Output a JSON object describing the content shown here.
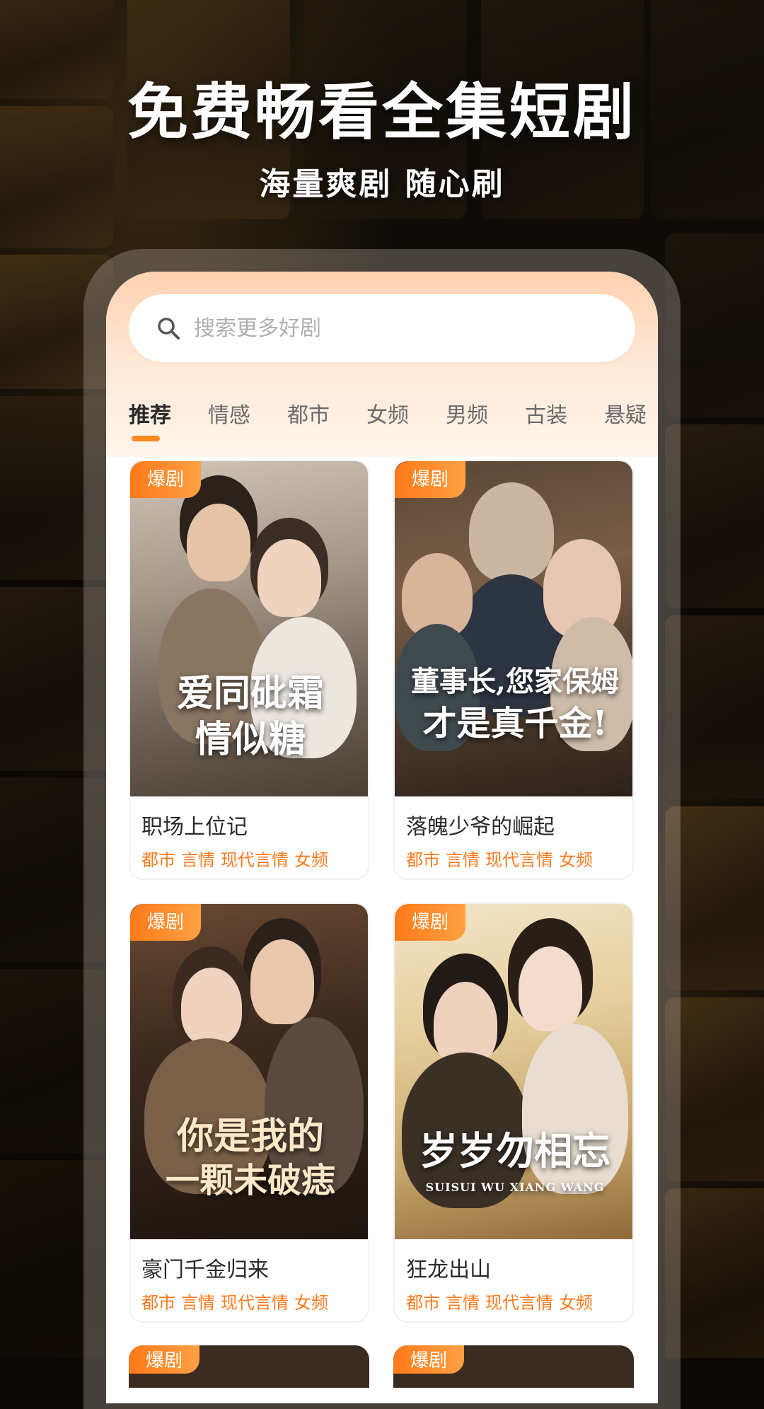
{
  "promo": {
    "headline": "免费畅看全集短剧",
    "subheadline": "海量爽剧 随心刷"
  },
  "search": {
    "placeholder": "搜索更多好剧",
    "icon": "search-icon"
  },
  "tabs": [
    {
      "label": "推荐",
      "active": true
    },
    {
      "label": "情感",
      "active": false
    },
    {
      "label": "都市",
      "active": false
    },
    {
      "label": "女频",
      "active": false
    },
    {
      "label": "男频",
      "active": false
    },
    {
      "label": "古装",
      "active": false
    },
    {
      "label": "悬疑",
      "active": false
    }
  ],
  "colors": {
    "accent": "#ff8a1f",
    "tag": "#ff7a1f",
    "badge_start": "#ff7a1a",
    "badge_end": "#ffa043"
  },
  "dramas": [
    {
      "badge": "爆剧",
      "title": "职场上位记",
      "tags": [
        "都市",
        "言情",
        "现代言情",
        "女频"
      ],
      "poster_title_line1": "爱同砒霜",
      "poster_title_line2": "情似糖"
    },
    {
      "badge": "爆剧",
      "title": "落魄少爷的崛起",
      "tags": [
        "都市",
        "言情",
        "现代言情",
        "女频"
      ],
      "poster_title_line1": "董事长,您家保姆",
      "poster_title_line2": "才是真千金!"
    },
    {
      "badge": "爆剧",
      "title": "豪门千金归来",
      "tags": [
        "都市",
        "言情",
        "现代言情",
        "女频"
      ],
      "poster_title_line1": "你是我的",
      "poster_title_line2": "一颗未破痣"
    },
    {
      "badge": "爆剧",
      "title": "狂龙出山",
      "tags": [
        "都市",
        "言情",
        "现代言情",
        "女频"
      ],
      "poster_title_line1": "岁岁勿相忘",
      "poster_title_line2": "SUISUI WU XIANG WANG"
    }
  ],
  "more_badges": [
    "爆剧",
    "爆剧"
  ]
}
